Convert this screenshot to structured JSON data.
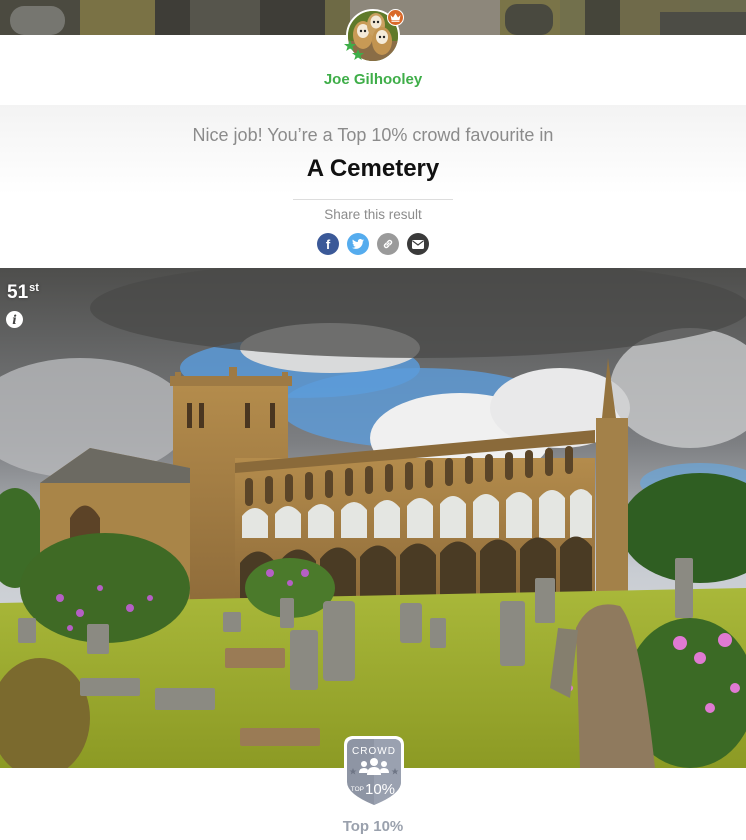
{
  "user": {
    "name": "Joe Gilhooley",
    "avatar_icon": "owls-avatar",
    "crown_icon": "crown-icon",
    "stars_icon": "stars-icon",
    "name_color": "#3fae49"
  },
  "result": {
    "message": "Nice job! You’re a Top 10% crowd favourite in",
    "category": "A Cemetery"
  },
  "share": {
    "label": "Share this result",
    "buttons": [
      {
        "name": "facebook",
        "icon": "facebook-icon",
        "glyph": "f",
        "color": "#3b5998"
      },
      {
        "name": "twitter",
        "icon": "twitter-icon",
        "glyph": "t",
        "color": "#55acee"
      },
      {
        "name": "link",
        "icon": "link-icon",
        "glyph": "∞",
        "color": "#9a9a9a"
      },
      {
        "name": "email",
        "icon": "mail-icon",
        "glyph": "✉",
        "color": "#3a3a3a"
      }
    ]
  },
  "photo": {
    "rank_number": "51",
    "rank_suffix": "st",
    "info_glyph": "i",
    "subject": "Abbey ruins cemetery with gravestones"
  },
  "badge": {
    "top_text": "CROWD",
    "bottom_small": "TOP",
    "bottom_big": "10%",
    "label": "Top 10%"
  }
}
